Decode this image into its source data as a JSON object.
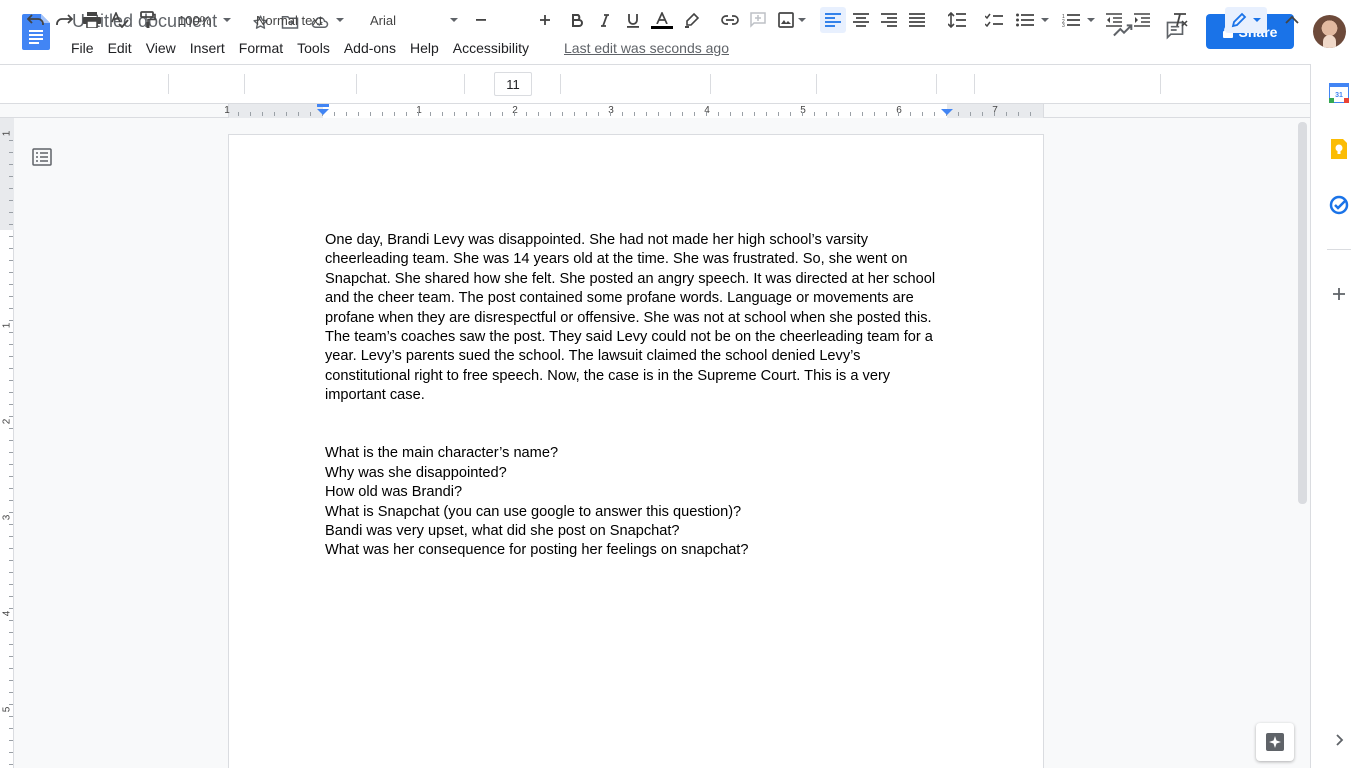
{
  "document": {
    "title": "Untitled document",
    "last_edit": "Last edit was seconds ago"
  },
  "menu": [
    "File",
    "Edit",
    "View",
    "Insert",
    "Format",
    "Tools",
    "Add-ons",
    "Help",
    "Accessibility"
  ],
  "header": {
    "share_label": "Share"
  },
  "toolbar": {
    "zoom": "100%",
    "style": "Normal text",
    "font": "Arial",
    "font_size": "11",
    "text_color": "#000000"
  },
  "ruler": {
    "horizontal_numbers": [
      "1",
      "1",
      "2",
      "3",
      "4",
      "5",
      "6",
      "7"
    ],
    "vertical_numbers": [
      "1",
      "1",
      "2",
      "3",
      "4",
      "5"
    ]
  },
  "body": {
    "paragraph": "One day, Brandi Levy was disappointed. She had not made her high school’s varsity cheerleading team. She was 14 years old at the time. She was frustrated. So, she went on Snapchat. She shared how she felt.  She posted an angry speech. It was directed at her school and the cheer team. The post contained some profane words. Language or movements are profane when they are disrespectful or offensive. She was not at school when she posted this. The team’s coaches saw the post. They said Levy could not be on the cheerleading team for a year. Levy’s parents sued the school. The lawsuit claimed the school denied Levy’s constitutional right to free speech. Now, the case is in the Supreme Court. This is a very important case.",
    "questions": [
      "What is the main character’s name?",
      "Why was she disappointed?",
      "How old was Brandi?",
      "What is Snapchat (you can use google to answer this question)?",
      "Bandi was very upset, what did she post on Snapchat?",
      "What was her consequence for posting her feelings on snapchat?"
    ]
  },
  "colors": {
    "accent": "#1a73e8",
    "docs_blue": "#4285f4",
    "keep_yellow": "#fbbc04"
  },
  "icons": {
    "side_panel": [
      "calendar-icon",
      "keep-icon",
      "tasks-icon",
      "add-icon"
    ]
  }
}
